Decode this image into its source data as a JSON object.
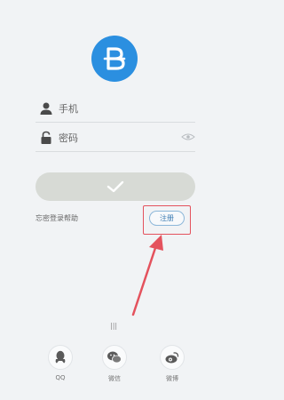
{
  "logo": {
    "letter": "B",
    "color": "#2b8fe0"
  },
  "form": {
    "username": {
      "placeholder": "手机",
      "icon": "user-icon"
    },
    "password": {
      "placeholder": "密码",
      "icon": "lock-icon",
      "toggle_icon": "eye-icon"
    }
  },
  "login_button": {
    "icon": "check-icon",
    "color": "#d7dad5"
  },
  "forgot_link": "忘密登录帮助",
  "register_button": {
    "label": "注册",
    "highlight_color": "#e4525d"
  },
  "divider_text": "|||",
  "social": [
    {
      "label": "QQ",
      "icon": "qq-icon"
    },
    {
      "label": "微信",
      "icon": "wechat-icon"
    },
    {
      "label": "微博",
      "icon": "weibo-icon"
    }
  ]
}
